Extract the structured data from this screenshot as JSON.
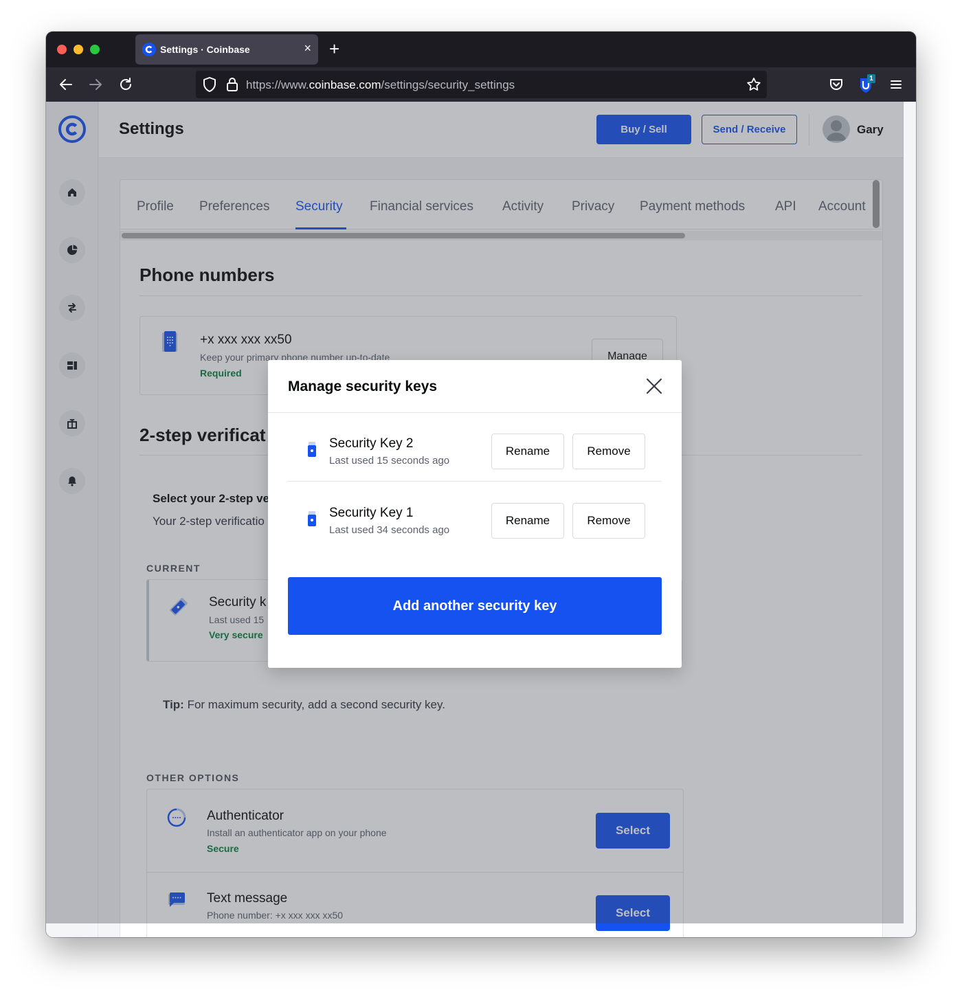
{
  "browser": {
    "tab_title": "Settings · Coinbase",
    "tab_close": "×",
    "new_tab": "+",
    "url_prefix": "https://www.",
    "url_domain": "coinbase.com",
    "url_path": "/settings/security_settings",
    "extension_badge": "1"
  },
  "header": {
    "title": "Settings",
    "buy_sell_label": "Buy / Sell",
    "send_receive_label": "Send / Receive",
    "user_name": "Gary"
  },
  "sidebar": {
    "items": [
      "home",
      "portfolio",
      "trade",
      "dashboard",
      "rewards",
      "notifications"
    ]
  },
  "tabs": [
    "Profile",
    "Preferences",
    "Security",
    "Financial services",
    "Activity",
    "Privacy",
    "Payment methods",
    "API",
    "Account"
  ],
  "active_tab": "Security",
  "phone_section": {
    "title": "Phone numbers",
    "number": "+x xxx xxx xx50",
    "description": "Keep your primary phone number up-to-date",
    "status": "Required",
    "manage_label": "Manage"
  },
  "two_step": {
    "title": "2-step verificat",
    "select_heading": "Select your 2-step ve",
    "select_text": "Your 2-step verificatio",
    "current_label": "CURRENT",
    "current_title": "Security k",
    "current_sub": "Last used 15",
    "current_status": "Very secure",
    "tip_label": "Tip:",
    "tip_text": " For maximum security, add a second security key.",
    "other_label": "OTHER OPTIONS",
    "options": [
      {
        "title": "Authenticator",
        "sub": "Install an authenticator app on your phone",
        "status": "Secure",
        "button": "Select"
      },
      {
        "title": "Text message",
        "sub": "Phone number: +x xxx xxx xx50",
        "status": "",
        "button": "Select"
      }
    ]
  },
  "modal": {
    "title": "Manage security keys",
    "keys": [
      {
        "name": "Security Key 2",
        "last_used": "Last used 15 seconds ago",
        "rename_label": "Rename",
        "remove_label": "Remove"
      },
      {
        "name": "Security Key 1",
        "last_used": "Last used 34 seconds ago",
        "rename_label": "Rename",
        "remove_label": "Remove"
      }
    ],
    "add_label": "Add another security key"
  },
  "colors": {
    "brand": "#1652f0",
    "positive": "#05803d"
  }
}
